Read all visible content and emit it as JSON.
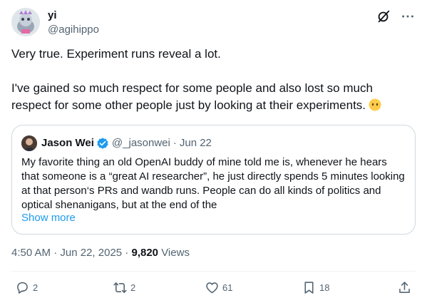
{
  "author": {
    "display_name": "yi",
    "handle": "@agihippo"
  },
  "tweet": {
    "paragraphs": [
      "Very true. Experiment runs reveal a lot.",
      "I've gained so much respect for some people and also lost so much respect for some other people just by looking at their experiments."
    ],
    "emoji": "face-without-mouth-emoji"
  },
  "quote": {
    "display_name": "Jason Wei",
    "handle": "@_jasonwei",
    "separator": "·",
    "date": "Jun 22",
    "text": "My favorite thing an old OpenAI buddy of mine told me is, whenever he hears that someone is a “great AI researcher”, he just directly spends 5 minutes looking at that person‘s PRs and wandb runs. People can do all kinds of politics and optical shenanigans, but at the end of the",
    "show_more": "Show more"
  },
  "meta": {
    "time": "4:50 AM",
    "separator": "·",
    "date": "Jun 22, 2025",
    "separator2": "·",
    "views_count": "9,820",
    "views_label": "Views"
  },
  "actions": {
    "replies": "2",
    "reposts": "2",
    "likes": "61",
    "bookmarks": "18"
  },
  "colors": {
    "accent": "#1d9bf0",
    "text": "#0f1419",
    "secondary": "#536471",
    "border": "#cfd9de"
  },
  "icons": [
    "grok-icon",
    "more-icon",
    "verified-icon",
    "reply-icon",
    "repost-icon",
    "like-icon",
    "bookmark-icon",
    "share-icon"
  ]
}
